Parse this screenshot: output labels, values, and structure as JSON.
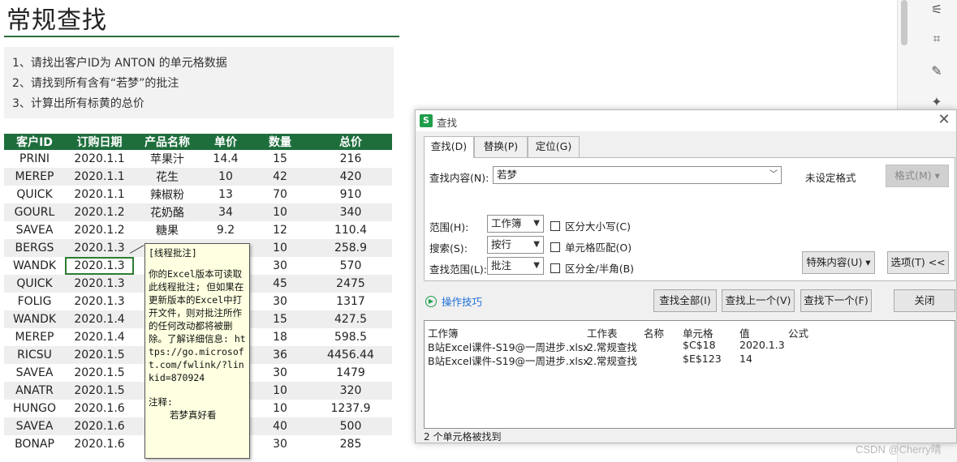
{
  "sheet": {
    "title": "常规查找",
    "tasks": [
      "1、请找出客户ID为 ANTON 的单元格数据",
      "2、请找到所有含有“若梦”的批注",
      "3、计算出所有标黄的总价"
    ],
    "table": {
      "headers": [
        "客户ID",
        "订购日期",
        "产品名称",
        "单价",
        "数量",
        "总价"
      ],
      "rows": [
        [
          "PRINI",
          "2020.1.1",
          "苹果汁",
          "14.4",
          "15",
          "216"
        ],
        [
          "MEREP",
          "2020.1.1",
          "花生",
          "10",
          "42",
          "420"
        ],
        [
          "QUICK",
          "2020.1.1",
          "辣椒粉",
          "13",
          "70",
          "910"
        ],
        [
          "GOURL",
          "2020.1.2",
          "花奶酪",
          "34",
          "10",
          "340"
        ],
        [
          "SAVEA",
          "2020.1.2",
          "糖果",
          "9.2",
          "12",
          "110.4"
        ],
        [
          "BERGS",
          "2020.1.3",
          "",
          "",
          "10",
          "258.9"
        ],
        [
          "WANDK",
          "2020.1.3",
          "",
          "",
          "30",
          "570"
        ],
        [
          "QUICK",
          "2020.1.3",
          "",
          "",
          "45",
          "2475"
        ],
        [
          "FOLIG",
          "2020.1.3",
          "",
          "",
          "30",
          "1317"
        ],
        [
          "WANDK",
          "2020.1.4",
          "",
          "",
          "15",
          "427.5"
        ],
        [
          "MEREP",
          "2020.1.4",
          "",
          "",
          "18",
          "598.5"
        ],
        [
          "RICSU",
          "2020.1.5",
          "",
          "",
          "36",
          "4456.44"
        ],
        [
          "SAVEA",
          "2020.1.5",
          "",
          "",
          "30",
          "1479"
        ],
        [
          "ANATR",
          "2020.1.5",
          "",
          "",
          "10",
          "320"
        ],
        [
          "HUNGO",
          "2020.1.6",
          "",
          "",
          "10",
          "1237.9"
        ],
        [
          "SAVEA",
          "2020.1.6",
          "",
          "",
          "40",
          "500"
        ],
        [
          "BONAP",
          "2020.1.6",
          "",
          "",
          "30",
          "285"
        ]
      ]
    },
    "comment": {
      "title": "[线程批注]",
      "body": "你的Excel版本可读取此线程批注; 但如果在更新版本的Excel中打开文件，则对批注所作的任何改动都将被删除。了解详细信息: https://go.microsoft.com/fwlink/?linkid=870924",
      "label": "注释:",
      "content": "若梦真好看"
    },
    "colors": {
      "header_bg": "#1e6e3c",
      "highlight": "#ffff00",
      "accent": "#2e6b3c"
    }
  },
  "dialog": {
    "title": "查找",
    "tabs": [
      "查找(D)",
      "替换(P)",
      "定位(G)"
    ],
    "find_label": "查找内容(N):",
    "find_value": "若梦",
    "format_status": "未设定格式",
    "format_button": "格式(M)",
    "scope_label": "范围(H):",
    "scope_value": "工作簿",
    "search_label": "搜索(S):",
    "search_value": "按行",
    "lookin_label": "查找范围(L):",
    "lookin_value": "批注",
    "match_case": "区分大小写(C)",
    "match_cell": "单元格匹配(O)",
    "match_width": "区分全/半角(B)",
    "special_button": "特殊内容(U)",
    "options_button": "选项(T) <<",
    "tips_link": "操作技巧",
    "find_all": "查找全部(I)",
    "find_prev": "查找上一个(V)",
    "find_next": "查找下一个(F)",
    "close_button": "关闭",
    "results": {
      "headers": [
        "工作簿",
        "工作表",
        "名称",
        "单元格",
        "值",
        "公式"
      ],
      "rows": [
        [
          "B站Excel课件-S19@一周进步.xlsx",
          "2.常规查找",
          "",
          "$C$18",
          "2020.1.3",
          ""
        ],
        [
          "B站Excel课件-S19@一周进步.xlsx",
          "2.常规查找",
          "",
          "$E$123",
          "14",
          ""
        ]
      ]
    },
    "status": "2 个单元格被找到"
  },
  "watermark": "CSDN @Cherry晴"
}
